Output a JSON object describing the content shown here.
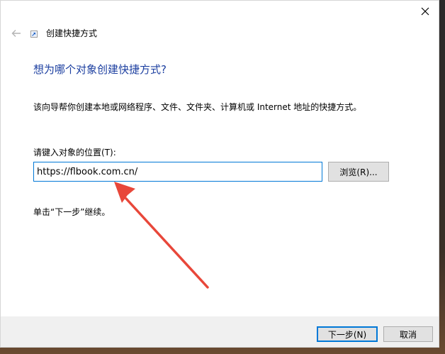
{
  "window": {
    "title": "创建快捷方式"
  },
  "page": {
    "heading": "想为哪个对象创建快捷方式?",
    "description": "该向导帮你创建本地或网络程序、文件、文件夹、计算机或 Internet 地址的快捷方式。",
    "field_label": "请键入对象的位置(T):",
    "location_value": "https://flbook.com.cn/",
    "browse_label": "浏览(R)...",
    "hint": "单击“下一步”继续。"
  },
  "footer": {
    "next_label": "下一步(N)",
    "cancel_label": "取消"
  },
  "icons": {
    "close": "close-icon",
    "back": "back-arrow-icon",
    "wizard": "shortcut-icon"
  },
  "colors": {
    "heading": "#1c3fa0",
    "focus_border": "#0078d7",
    "annotation_arrow": "#e8473a",
    "footer_bg": "#f0f0f0"
  }
}
